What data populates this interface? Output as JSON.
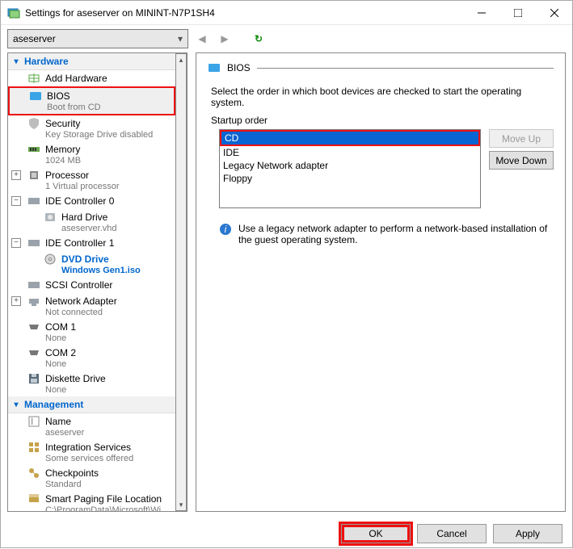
{
  "title": "Settings for aseserver on MININT-N7P1SH4",
  "combo_value": "aseserver",
  "sections": {
    "hardware": "Hardware",
    "management": "Management"
  },
  "tree": {
    "add_hardware": "Add Hardware",
    "bios": {
      "label": "BIOS",
      "sub": "Boot from CD"
    },
    "security": {
      "label": "Security",
      "sub": "Key Storage Drive disabled"
    },
    "memory": {
      "label": "Memory",
      "sub": "1024 MB"
    },
    "processor": {
      "label": "Processor",
      "sub": "1 Virtual processor"
    },
    "ide0": {
      "label": "IDE Controller 0"
    },
    "harddrive": {
      "label": "Hard Drive",
      "sub": "aseserver.vhd"
    },
    "ide1": {
      "label": "IDE Controller 1"
    },
    "dvd": {
      "label": "DVD Drive",
      "sub": "Windows Gen1.iso"
    },
    "scsi": {
      "label": "SCSI Controller"
    },
    "netadapter": {
      "label": "Network Adapter",
      "sub": "Not connected"
    },
    "com1": {
      "label": "COM 1",
      "sub": "None"
    },
    "com2": {
      "label": "COM 2",
      "sub": "None"
    },
    "diskette": {
      "label": "Diskette Drive",
      "sub": "None"
    },
    "name": {
      "label": "Name",
      "sub": "aseserver"
    },
    "integration": {
      "label": "Integration Services",
      "sub": "Some services offered"
    },
    "checkpoints": {
      "label": "Checkpoints",
      "sub": "Standard"
    },
    "paging": {
      "label": "Smart Paging File Location",
      "sub": "C:\\ProgramData\\Microsoft\\Win..."
    }
  },
  "right": {
    "heading": "BIOS",
    "desc": "Select the order in which boot devices are checked to start the operating system.",
    "group": "Startup order",
    "items": [
      "CD",
      "IDE",
      "Legacy Network adapter",
      "Floppy"
    ],
    "moveup": "Move Up",
    "movedown": "Move Down",
    "info": "Use a legacy network adapter to perform a network-based installation of the guest operating system."
  },
  "footer": {
    "ok": "OK",
    "cancel": "Cancel",
    "apply": "Apply"
  }
}
